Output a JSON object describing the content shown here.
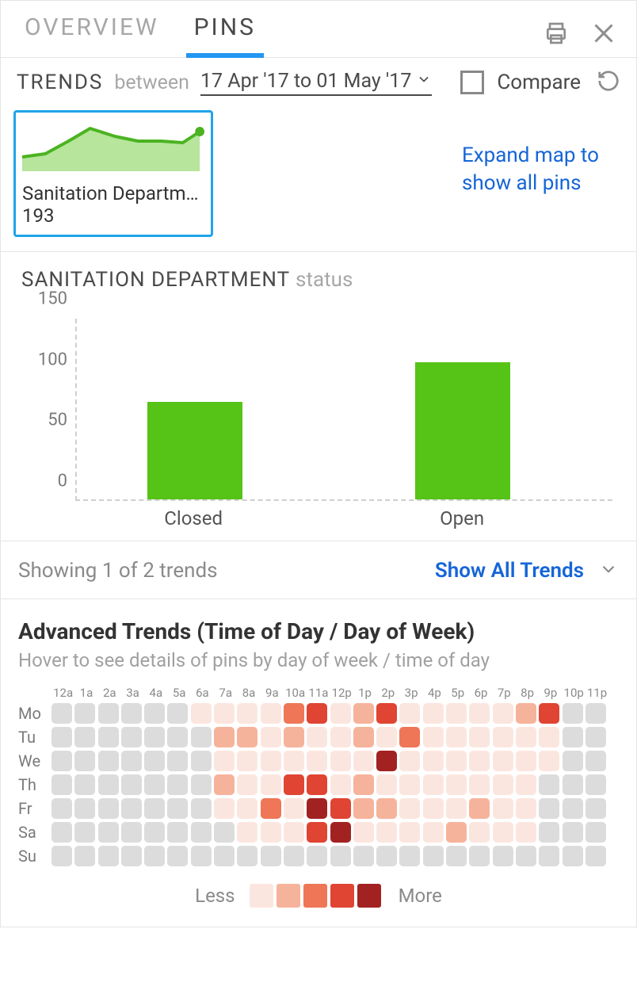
{
  "tabs": {
    "overview": "OVERVIEW",
    "pins": "PINS",
    "active": "pins"
  },
  "filter": {
    "trends_label": "TRENDS",
    "between_label": "between",
    "date_range": "17 Apr '17 to 01 May '17",
    "compare_label": "Compare"
  },
  "trend_card": {
    "title": "Sanitation Departme...",
    "value": "193"
  },
  "expand_link": "Expand map to show all pins",
  "bar_chart": {
    "title_main": "SANITATION DEPARTMENT",
    "title_suffix": "status"
  },
  "chart_data": {
    "type": "bar",
    "title": "SANITATION DEPARTMENT status",
    "ylabel": "",
    "xlabel": "",
    "ylim": [
      0,
      150
    ],
    "yticks": [
      0,
      50,
      100,
      150
    ],
    "categories": [
      "Closed",
      "Open"
    ],
    "values": [
      80,
      113
    ],
    "bar_color": "#56c317"
  },
  "showing": {
    "text": "Showing 1 of 2 trends",
    "link": "Show All Trends"
  },
  "advanced": {
    "title": "Advanced Trends (Time of Day / Day of Week)",
    "subtitle": "Hover to see details of pins by day of week / time of day",
    "hours": [
      "12a",
      "1a",
      "2a",
      "3a",
      "4a",
      "5a",
      "6a",
      "7a",
      "8a",
      "9a",
      "10a",
      "11a",
      "12p",
      "1p",
      "2p",
      "3p",
      "4p",
      "5p",
      "6p",
      "7p",
      "8p",
      "9p",
      "10p",
      "11p"
    ],
    "days": [
      "Mo",
      "Tu",
      "We",
      "Th",
      "Fr",
      "Sa",
      "Su"
    ],
    "heat": [
      [
        0,
        0,
        0,
        0,
        0,
        0,
        1,
        1,
        1,
        1,
        3,
        4,
        1,
        2,
        4,
        1,
        1,
        1,
        1,
        1,
        2,
        4,
        0,
        0
      ],
      [
        0,
        0,
        0,
        0,
        0,
        0,
        0,
        2,
        2,
        1,
        2,
        1,
        1,
        2,
        1,
        3,
        1,
        1,
        1,
        1,
        1,
        1,
        0,
        0
      ],
      [
        0,
        0,
        0,
        0,
        0,
        0,
        0,
        1,
        1,
        1,
        1,
        1,
        1,
        1,
        5,
        1,
        1,
        1,
        1,
        1,
        1,
        1,
        0,
        0
      ],
      [
        0,
        0,
        0,
        0,
        0,
        0,
        0,
        2,
        1,
        1,
        4,
        4,
        1,
        2,
        1,
        1,
        1,
        1,
        1,
        1,
        1,
        0,
        0,
        0
      ],
      [
        0,
        0,
        0,
        0,
        0,
        0,
        0,
        1,
        1,
        3,
        1,
        5,
        4,
        2,
        2,
        1,
        1,
        1,
        2,
        1,
        1,
        0,
        0,
        0
      ],
      [
        0,
        0,
        0,
        0,
        0,
        0,
        0,
        0,
        1,
        1,
        1,
        4,
        5,
        1,
        1,
        1,
        1,
        2,
        1,
        1,
        1,
        0,
        0,
        0
      ],
      [
        0,
        0,
        0,
        0,
        0,
        0,
        0,
        0,
        0,
        0,
        0,
        0,
        0,
        0,
        0,
        0,
        0,
        0,
        0,
        0,
        0,
        0,
        0,
        0
      ]
    ],
    "legend_less": "Less",
    "legend_more": "More",
    "legend_levels": [
      1,
      2,
      3,
      4,
      5
    ]
  }
}
